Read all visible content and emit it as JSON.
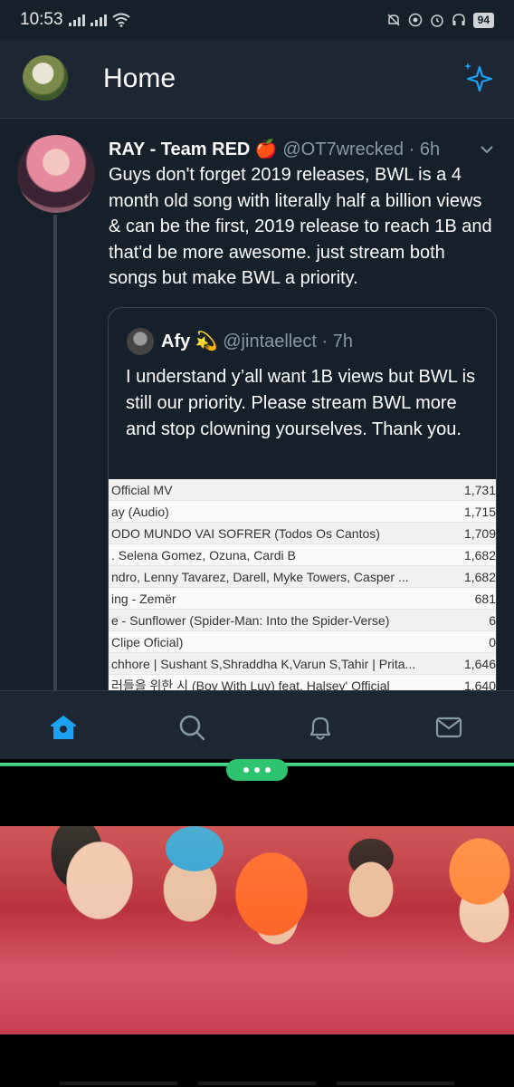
{
  "status_bar": {
    "time": "10:53",
    "battery": "94",
    "icons": [
      "signal-icon",
      "wifi-icon",
      "mute-icon",
      "data-saver-icon",
      "alarm-icon",
      "headset-icon",
      "battery-icon"
    ]
  },
  "header": {
    "title": "Home",
    "right_icon": "sparkle-icon"
  },
  "tweet": {
    "author": "RAY - Team RED 🍎",
    "handle": "@OT7wrecked",
    "time": "· 6h",
    "text": "Guys don't forget 2019 releases, BWL is a 4 month old song with literally half a billion views & can be the first, 2019 release to reach 1B and that'd be more awesome. just stream both songs but make BWL a priority.",
    "quote": {
      "author": "Afy 💫",
      "handle": "@jintaellect",
      "time": "· 7h",
      "text": "I understand y’all want 1B views but BWL is still our priority. Please stream BWL more and stop clowning yourselves. Thank you.",
      "rows": [
        {
          "title": "Official MV",
          "views": "1,731"
        },
        {
          "title": "ay (Audio)",
          "views": "1,715"
        },
        {
          "title": "ODO MUNDO VAI SOFRER (Todos Os Cantos)",
          "views": "1,709"
        },
        {
          "title": ". Selena Gomez, Ozuna, Cardi B",
          "views": "1,682"
        },
        {
          "title": "ndro, Lenny Tavarez, Darell, Myke Towers, Casper ...",
          "views": "1,682"
        },
        {
          "title": "ing - Zemër",
          "views": "681"
        },
        {
          "title": "e - Sunflower (Spider-Man: Into the Spider-Verse)",
          "views": "6"
        },
        {
          "title": "Clipe Oficial)",
          "views": "0"
        },
        {
          "title": "chhore | Sushant S,Shraddha K,Varun S,Tahir | Prita...",
          "views": "1,646"
        },
        {
          "title": "러들을 위한 시 (Boy With Luv) feat. Halsey' Official",
          "views": "1,640"
        }
      ]
    }
  },
  "fab": {
    "icon": "compose-tweet-icon"
  },
  "bottom_nav": [
    {
      "name": "home",
      "icon": "home-icon",
      "active": true
    },
    {
      "name": "search",
      "icon": "search-icon",
      "active": false
    },
    {
      "name": "notifications",
      "icon": "bell-icon",
      "active": false
    },
    {
      "name": "messages",
      "icon": "mail-icon",
      "active": false
    }
  ],
  "colors": {
    "accent": "#1da1f2",
    "background": "#15202b",
    "header": "#1c2733",
    "muted": "#8899a6",
    "split": "#2ec46f"
  }
}
